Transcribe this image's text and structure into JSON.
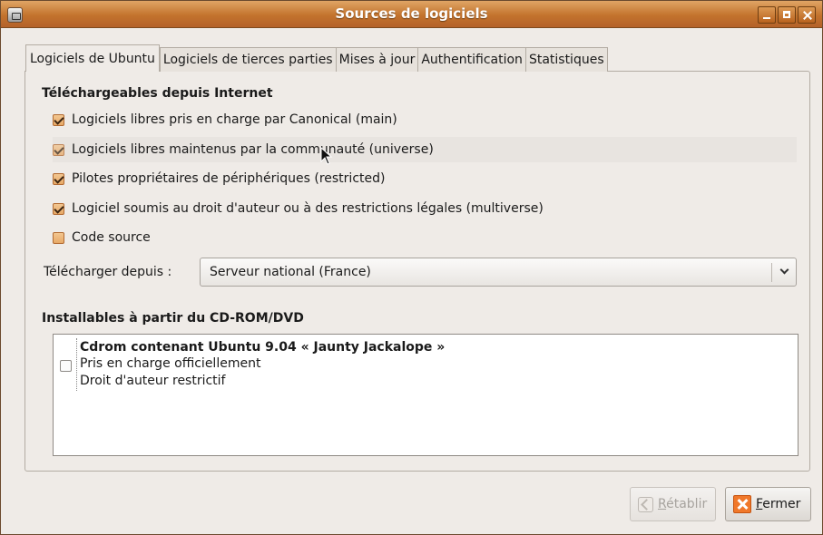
{
  "window": {
    "title": "Sources de logiciels"
  },
  "tabs": [
    {
      "label": "Logiciels de Ubuntu",
      "active": true
    },
    {
      "label": "Logiciels de tierces parties",
      "active": false
    },
    {
      "label": "Mises à jour",
      "active": false
    },
    {
      "label": "Authentification",
      "active": false
    },
    {
      "label": "Statistiques",
      "active": false
    }
  ],
  "internet": {
    "title": "Téléchargeables depuis Internet",
    "options": [
      {
        "label": "Logiciels libres pris en charge par Canonical (main)",
        "checked": true
      },
      {
        "label": "Logiciels libres maintenus par la communauté (universe)",
        "checked": true
      },
      {
        "label": "Pilotes propriétaires de périphériques (restricted)",
        "checked": true
      },
      {
        "label": "Logiciel soumis au droit d'auteur ou à des restrictions légales (multiverse)",
        "checked": true
      },
      {
        "label": "Code source",
        "checked": false
      }
    ],
    "download_from_label": "Télécharger depuis :",
    "download_from_value": "Serveur national (France)"
  },
  "cdrom": {
    "title": "Installables à partir du CD-ROM/DVD",
    "item": {
      "name": "Cdrom contenant Ubuntu 9.04 « Jaunty Jackalope »",
      "line1": "Pris en charge officiellement",
      "line2": "Droit d'auteur restrictif",
      "checked": false
    }
  },
  "buttons": {
    "revert_prefix": "",
    "revert_mnemonic": "R",
    "revert_rest": "établir",
    "close_mnemonic": "F",
    "close_rest": "ermer"
  },
  "colors": {
    "titlebar": "#c3732d",
    "checkbox": "#e7a967",
    "window_bg": "#efebe7"
  }
}
